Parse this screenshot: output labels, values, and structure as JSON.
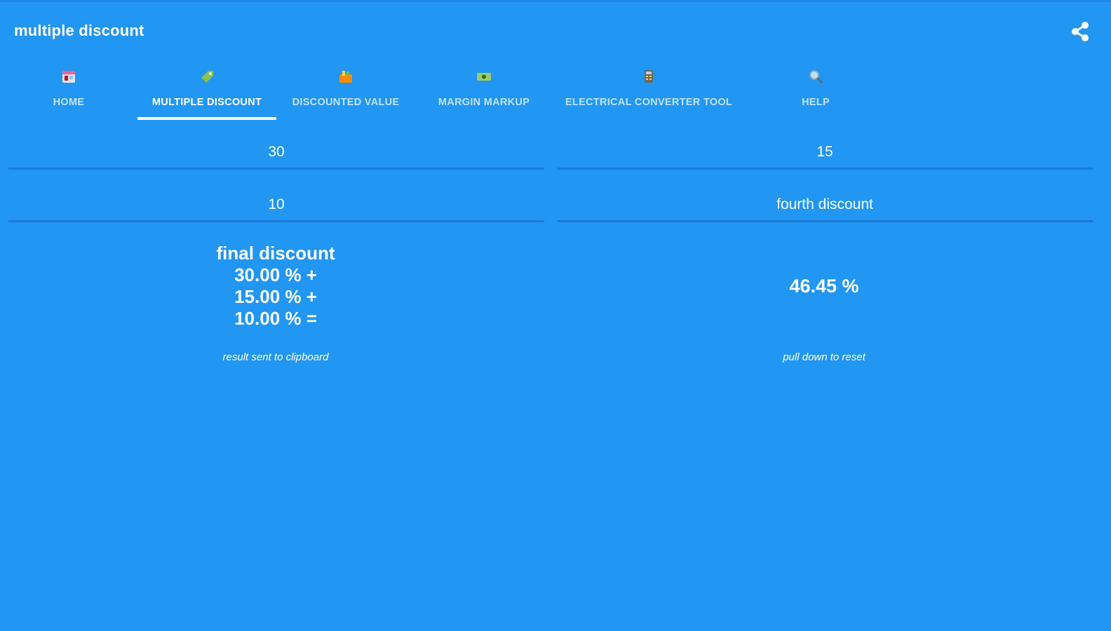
{
  "app": {
    "title": "multiple discount",
    "share_icon": "share-icon",
    "colors": {
      "background": "#2196f3",
      "divider": "#1b7ad6",
      "text": "#ffffff"
    }
  },
  "tabs": [
    {
      "label": "HOME",
      "icon": "store-icon",
      "active": false
    },
    {
      "label": "MULTIPLE DISCOUNT",
      "icon": "tag-icon",
      "active": true
    },
    {
      "label": "DISCOUNTED VALUE",
      "icon": "shopping-basket-icon",
      "active": false
    },
    {
      "label": "MARGIN MARKUP",
      "icon": "banknote-icon",
      "active": false
    },
    {
      "label": "ELECTRICAL CONVERTER TOOL",
      "icon": "calculator-icon",
      "active": false
    },
    {
      "label": "HELP",
      "icon": "magnifier-icon",
      "active": false
    }
  ],
  "inputs": {
    "first": {
      "value": "30",
      "placeholder": ""
    },
    "second": {
      "value": "15",
      "placeholder": ""
    },
    "third": {
      "value": "10",
      "placeholder": ""
    },
    "fourth": {
      "value": "",
      "placeholder": "fourth discount"
    }
  },
  "result": {
    "heading": "final discount",
    "lines": [
      "30.00 % +",
      "15.00 % +",
      "10.00 % ="
    ],
    "value": "46.45 %"
  },
  "hints": {
    "clipboard": "result sent to clipboard",
    "reset": "pull down to reset"
  }
}
